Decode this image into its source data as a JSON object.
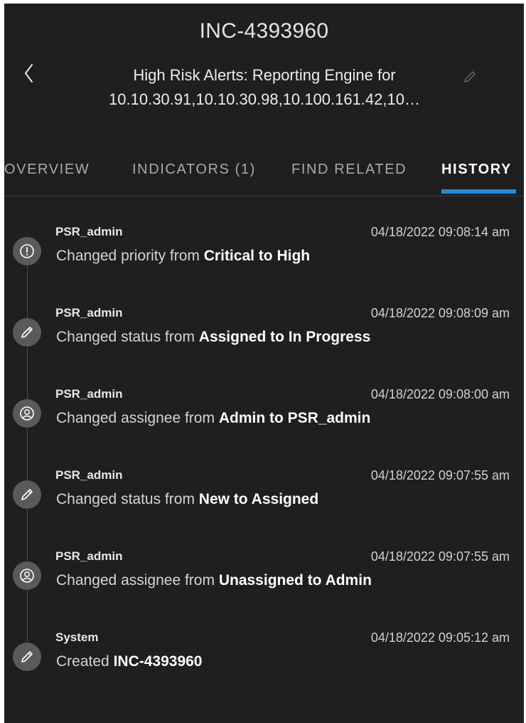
{
  "header": {
    "incident_id": "INC-4393960",
    "title_line1": "High Risk Alerts: Reporting Engine for",
    "title_line2": "10.10.30.91,10.10.30.98,10.100.161.42,10…"
  },
  "tabs": [
    {
      "label": "OVERVIEW",
      "active": false
    },
    {
      "label": "INDICATORS (1)",
      "active": false
    },
    {
      "label": "FIND RELATED",
      "active": false
    },
    {
      "label": "HISTORY",
      "active": true
    }
  ],
  "history": [
    {
      "icon": "alert-icon",
      "user": "PSR_admin",
      "time": "04/18/2022 09:08:14 am",
      "prefix": "Changed priority from",
      "detail": "Critical to High"
    },
    {
      "icon": "pencil-icon",
      "user": "PSR_admin",
      "time": "04/18/2022 09:08:09 am",
      "prefix": "Changed status from",
      "detail": "Assigned to In Progress"
    },
    {
      "icon": "user-icon",
      "user": "PSR_admin",
      "time": "04/18/2022 09:08:00 am",
      "prefix": "Changed assignee from",
      "detail": "Admin to PSR_admin"
    },
    {
      "icon": "pencil-icon",
      "user": "PSR_admin",
      "time": "04/18/2022 09:07:55 am",
      "prefix": "Changed status from",
      "detail": "New to Assigned"
    },
    {
      "icon": "user-icon",
      "user": "PSR_admin",
      "time": "04/18/2022 09:07:55 am",
      "prefix": "Changed assignee from",
      "detail": "Unassigned to Admin"
    },
    {
      "icon": "pencil-icon",
      "user": "System",
      "time": "04/18/2022 09:05:12 am",
      "prefix": "Created",
      "detail": "INC-4393960"
    }
  ],
  "colors": {
    "background": "#1f1f20",
    "accent": "#1f8fdc",
    "icon_circle": "#5a5a5c"
  }
}
